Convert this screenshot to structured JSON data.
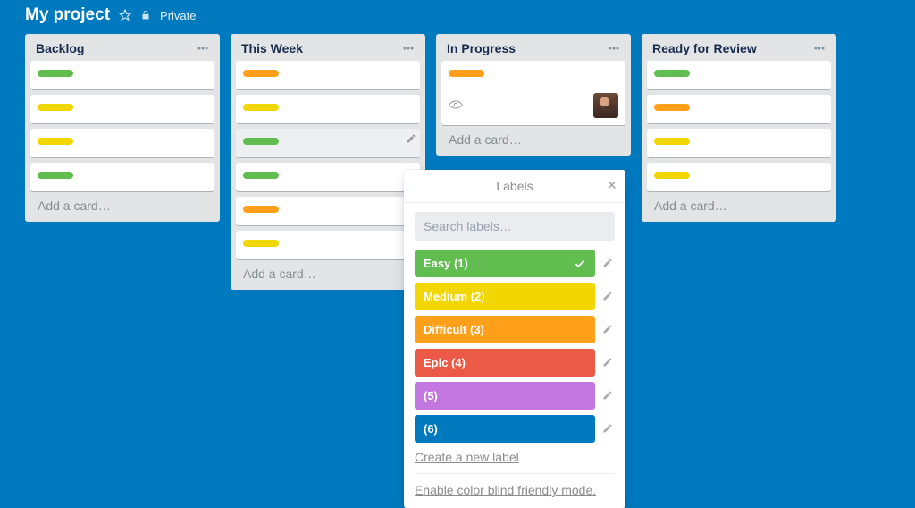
{
  "header": {
    "title": "My project",
    "privacy": "Private"
  },
  "colors": {
    "green": "#61bd4f",
    "yellow": "#f2d600",
    "orange": "#ff9f1a",
    "red": "#eb5a46",
    "purple": "#c377e0",
    "blue": "#0079bf"
  },
  "lists": [
    {
      "title": "Backlog",
      "cards": [
        {
          "label": "green"
        },
        {
          "label": "yellow"
        },
        {
          "label": "yellow"
        },
        {
          "label": "green"
        }
      ],
      "add_text": "Add a card…"
    },
    {
      "title": "This Week",
      "cards": [
        {
          "label": "orange"
        },
        {
          "label": "yellow"
        },
        {
          "label": "green",
          "hover": true
        },
        {
          "label": "green"
        },
        {
          "label": "orange"
        },
        {
          "label": "yellow"
        }
      ],
      "add_text": "Add a card…"
    },
    {
      "title": "In Progress",
      "cards": [
        {
          "label": "orange",
          "watch": true,
          "avatar": true
        }
      ],
      "add_text": "Add a card…"
    },
    {
      "title": "Ready for Review",
      "cards": [
        {
          "label": "green"
        },
        {
          "label": "orange"
        },
        {
          "label": "yellow"
        },
        {
          "label": "yellow"
        }
      ],
      "add_text": "Add a card…"
    }
  ],
  "popover": {
    "title": "Labels",
    "search_placeholder": "Search labels…",
    "labels": [
      {
        "name": "Easy (1)",
        "color": "green",
        "selected": true
      },
      {
        "name": "Medium (2)",
        "color": "yellow",
        "selected": false
      },
      {
        "name": "Difficult (3)",
        "color": "orange",
        "selected": false
      },
      {
        "name": "Epic (4)",
        "color": "red",
        "selected": false
      },
      {
        "name": "(5)",
        "color": "purple",
        "selected": false
      },
      {
        "name": "(6)",
        "color": "blue",
        "selected": false
      }
    ],
    "create_text": "Create a new label",
    "colorblind_text": "Enable color blind friendly mode."
  }
}
